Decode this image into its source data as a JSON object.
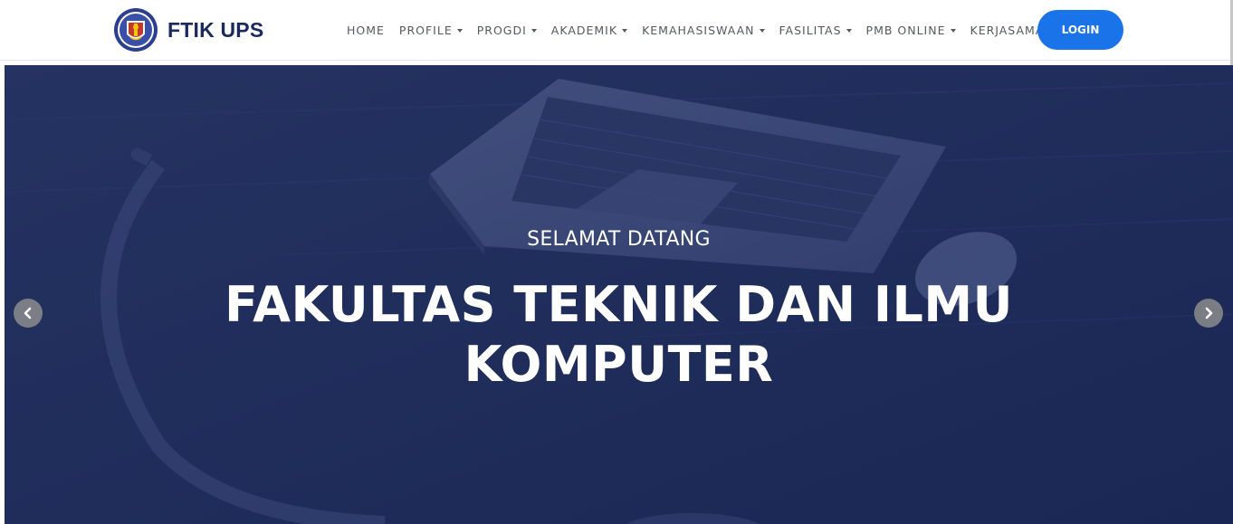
{
  "brand": {
    "name": "FTIK UPS",
    "logo_icon": "university-crest-logo"
  },
  "nav": {
    "items": [
      {
        "label": "HOME",
        "dropdown": false
      },
      {
        "label": "PROFILE",
        "dropdown": true
      },
      {
        "label": "PROGDI",
        "dropdown": true
      },
      {
        "label": "AKADEMIK",
        "dropdown": true
      },
      {
        "label": "KEMAHASISWAAN",
        "dropdown": true
      },
      {
        "label": "FASILITAS",
        "dropdown": true
      },
      {
        "label": "PMB ONLINE",
        "dropdown": true
      },
      {
        "label": "KERJASAMA",
        "dropdown": false
      }
    ],
    "login_label": "LOGIN"
  },
  "hero": {
    "subtitle": "SELAMAT DATANG",
    "title_line1": "FAKULTAS TEKNIK DAN ILMU",
    "title_line2": "KOMPUTER",
    "prev_icon": "chevron-left-icon",
    "next_icon": "chevron-right-icon"
  },
  "colors": {
    "brand_text": "#1b2a5e",
    "login_button": "#1a73e8",
    "hero_overlay": "#1f2c57",
    "nav_text": "#555a60"
  }
}
